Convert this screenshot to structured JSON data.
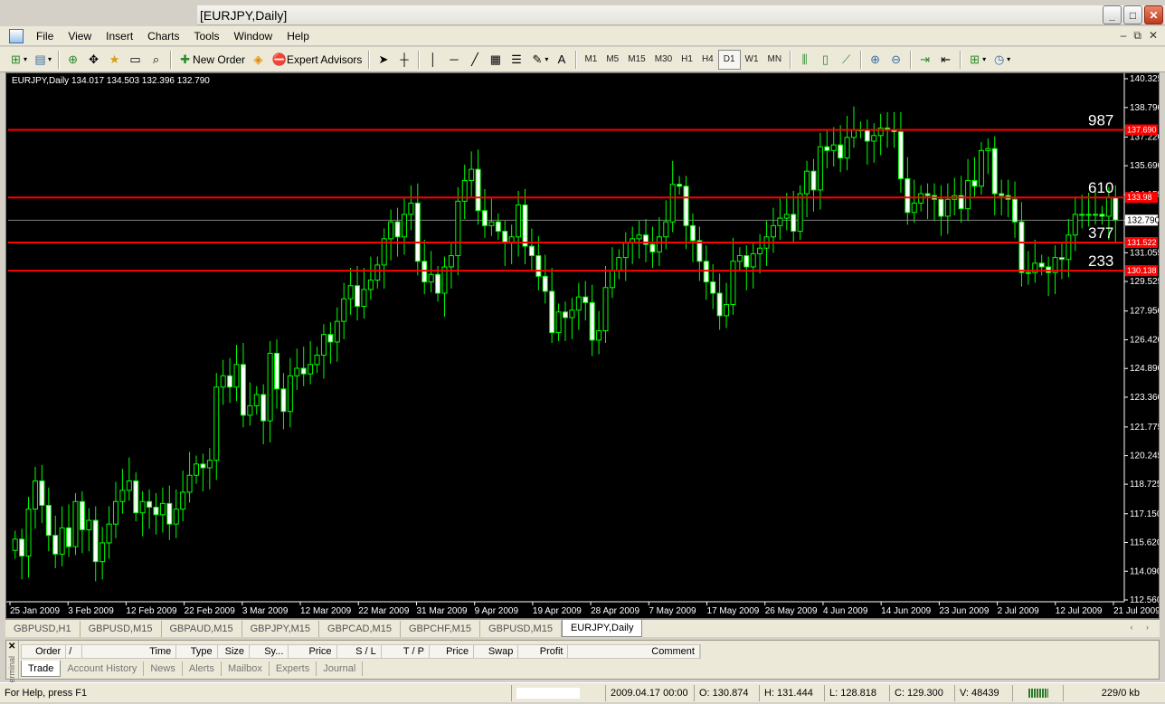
{
  "window": {
    "title": "[EURJPY,Daily]",
    "minimize": "_",
    "maximize": "□",
    "close": "✕"
  },
  "menu": {
    "items": [
      "File",
      "View",
      "Insert",
      "Charts",
      "Tools",
      "Window",
      "Help"
    ],
    "mdi": [
      "–",
      "⧉",
      "✕"
    ]
  },
  "toolbar": {
    "new_order": "New Order",
    "expert_advisors": "Expert Advisors",
    "text_tool": "A",
    "timeframes": [
      "M1",
      "M5",
      "M15",
      "M30",
      "H1",
      "H4",
      "D1",
      "W1",
      "MN"
    ],
    "active_timeframe": "D1"
  },
  "chart_info": "EURJPY,Daily  134.017 134.503 132.396 132.790",
  "chart_data": {
    "type": "candlestick",
    "symbol": "EURJPY",
    "timeframe": "Daily",
    "ohlc_header": {
      "open": 134.017,
      "high": 134.503,
      "low": 132.396,
      "close": 132.79
    },
    "ylim": [
      112.56,
      140.325
    ],
    "y_ticks": [
      "140.325",
      "138.790",
      "137.220",
      "135.690",
      "134.155",
      "132.790",
      "131.055",
      "129.525",
      "127.950",
      "126.420",
      "124.890",
      "123.360",
      "121.775",
      "120.245",
      "118.725",
      "117.150",
      "115.620",
      "114.090",
      "112.560"
    ],
    "x_ticks": [
      "25 Jan 2009",
      "3 Feb 2009",
      "12 Feb 2009",
      "22 Feb 2009",
      "3 Mar 2009",
      "12 Mar 2009",
      "22 Mar 2009",
      "31 Mar 2009",
      "9 Apr 2009",
      "19 Apr 2009",
      "28 Apr 2009",
      "7 May 2009",
      "17 May 2009",
      "26 May 2009",
      "4 Jun 2009",
      "14 Jun 2009",
      "23 Jun 2009",
      "2 Jul 2009",
      "12 Jul 2009",
      "21 Jul 2009"
    ],
    "current_price": 132.79,
    "horizontal_lines": [
      {
        "label": "987",
        "price": 137.6,
        "tag": "137.690"
      },
      {
        "label": "610",
        "price": 134.0,
        "tag": "133.98"
      },
      {
        "label": "377",
        "price": 131.6,
        "tag": "131.522"
      },
      {
        "label": "233",
        "price": 130.1,
        "tag": "130.138"
      }
    ],
    "closes": [
      115.8,
      114.9,
      117.4,
      118.9,
      117.6,
      116.0,
      115.0,
      116.4,
      115.4,
      117.8,
      116.3,
      116.8,
      114.6,
      115.6,
      116.6,
      117.8,
      118.4,
      118.9,
      117.2,
      117.8,
      117.5,
      117.1,
      117.7,
      116.6,
      117.4,
      118.3,
      119.2,
      119.8,
      119.6,
      120.0,
      123.9,
      124.5,
      123.9,
      125.1,
      122.4,
      122.9,
      123.5,
      122.1,
      125.7,
      123.8,
      122.6,
      124.5,
      124.9,
      124.6,
      125.1,
      125.6,
      126.7,
      126.3,
      127.4,
      128.6,
      129.3,
      128.2,
      129.1,
      129.6,
      130.4,
      131.8,
      132.7,
      131.9,
      133.1,
      133.7,
      130.6,
      129.5,
      129.9,
      128.9,
      130.3,
      130.9,
      133.8,
      134.9,
      135.5,
      133.3,
      132.5,
      132.7,
      132.2,
      131.6,
      131.9,
      133.6,
      131.4,
      130.9,
      129.8,
      129.0,
      126.8,
      127.9,
      127.6,
      128.0,
      128.7,
      128.4,
      126.4,
      126.9,
      129.2,
      130.1,
      130.8,
      131.6,
      131.8,
      132.0,
      131.5,
      131.1,
      131.9,
      132.7,
      134.7,
      134.6,
      132.5,
      131.7,
      130.6,
      129.5,
      128.9,
      127.7,
      128.3,
      130.6,
      130.9,
      130.3,
      131.0,
      131.3,
      131.9,
      132.5,
      132.9,
      133.1,
      132.2,
      134.2,
      135.4,
      134.4,
      136.7,
      136.5,
      136.8,
      136.1,
      137.2,
      137.6,
      137.6,
      137.0,
      137.3,
      137.7,
      137.6,
      137.5,
      135.0,
      133.2,
      133.7,
      134.2,
      134.1,
      133.9,
      133.0,
      133.9,
      134.1,
      133.4,
      134.9,
      134.6,
      136.5,
      136.6,
      134.2,
      134.1,
      133.9,
      132.7,
      130.0,
      130.0,
      130.5,
      130.3,
      130.0,
      130.8,
      130.7,
      132.0,
      133.1,
      133.1,
      133.1,
      133.1,
      133.0,
      134.0,
      132.8
    ]
  },
  "symbol_tabs": [
    "GBPUSD,H1",
    "GBPUSD,M15",
    "GBPAUD,M15",
    "GBPJPY,M15",
    "GBPCAD,M15",
    "GBPCHF,M15",
    "GBPUSD,M15",
    "EURJPY,Daily"
  ],
  "tab_arrows": "‹ ›",
  "terminal": {
    "close_glyph": "✕",
    "side_label": "Terminal",
    "columns": [
      "Order",
      "/",
      "Time",
      "Type",
      "Size",
      "Sy...",
      "Price",
      "S / L",
      "T / P",
      "Price",
      "Swap",
      "Profit",
      "Comment"
    ],
    "tabs": [
      "Trade",
      "Account History",
      "News",
      "Alerts",
      "Mailbox",
      "Experts",
      "Journal"
    ]
  },
  "status": {
    "help": "For Help, press F1",
    "datetime": "2009.04.17 00:00",
    "open": "O: 130.874",
    "high": "H: 131.444",
    "low": "L: 128.818",
    "close": "C: 129.300",
    "volume": "V: 48439",
    "traffic": "229/0 kb"
  },
  "colors": {
    "bull": "#00ff00",
    "bear": "#ffffff",
    "level_line": "#ff0000",
    "background": "#000000",
    "axis": "#ffffff"
  }
}
